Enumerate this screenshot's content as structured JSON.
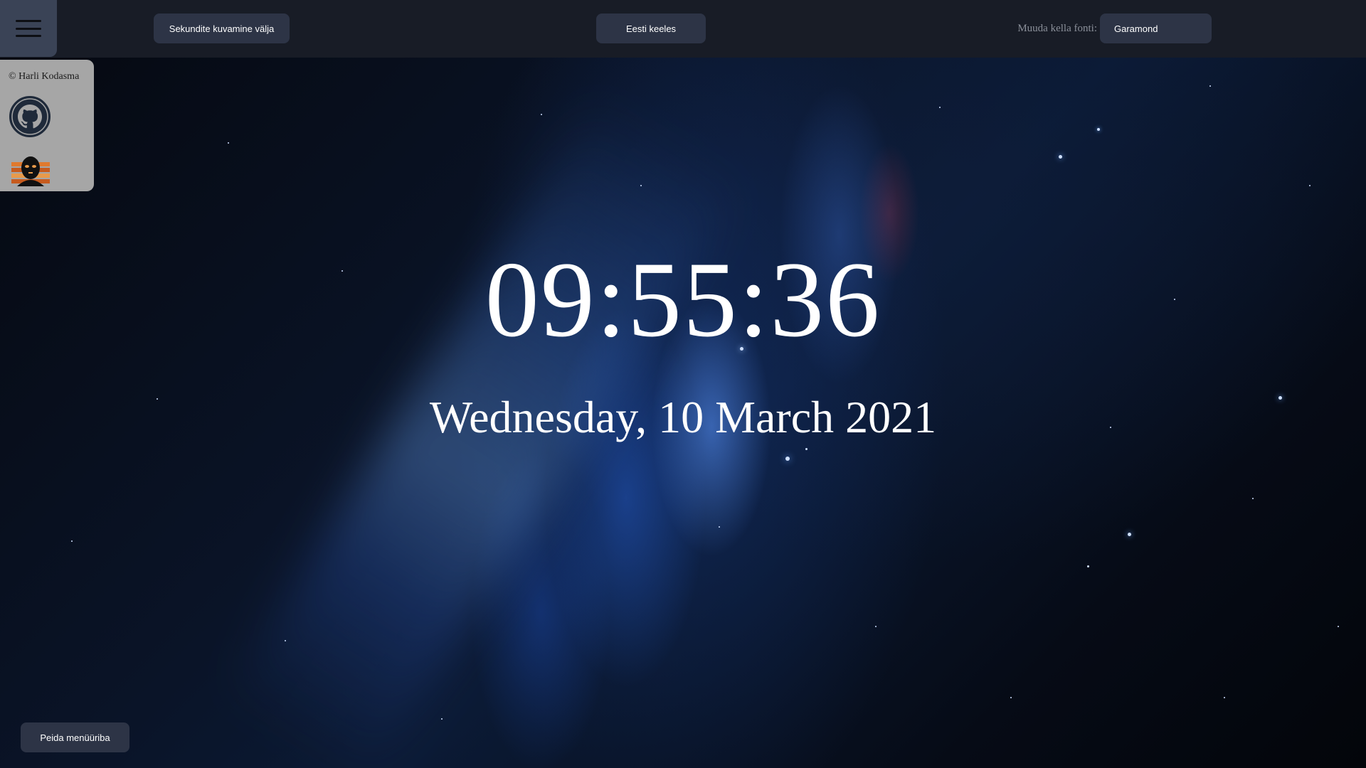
{
  "topbar": {
    "menu_icon": "hamburger-icon",
    "seconds_button": "Sekundite kuvamine välja",
    "language_button": "Eesti keeles",
    "font_label": "Muuda kella fonti:",
    "font_select_value": "Garamond"
  },
  "side_panel": {
    "copyright": "© Harli Kodasma",
    "github_icon": "github-icon",
    "avatar_icon": "masked-figure-avatar-icon"
  },
  "clock": {
    "time": "09:55:36",
    "date": "Wednesday, 10 March 2021"
  },
  "footer": {
    "hide_menu_button": "Peida menüüriba"
  },
  "colors": {
    "topbar_bg": "#181c26",
    "button_bg": "#2d3446",
    "menu_button_bg": "#3a4356",
    "side_panel_bg": "#a6a6a6",
    "clock_text": "#ffffff"
  }
}
